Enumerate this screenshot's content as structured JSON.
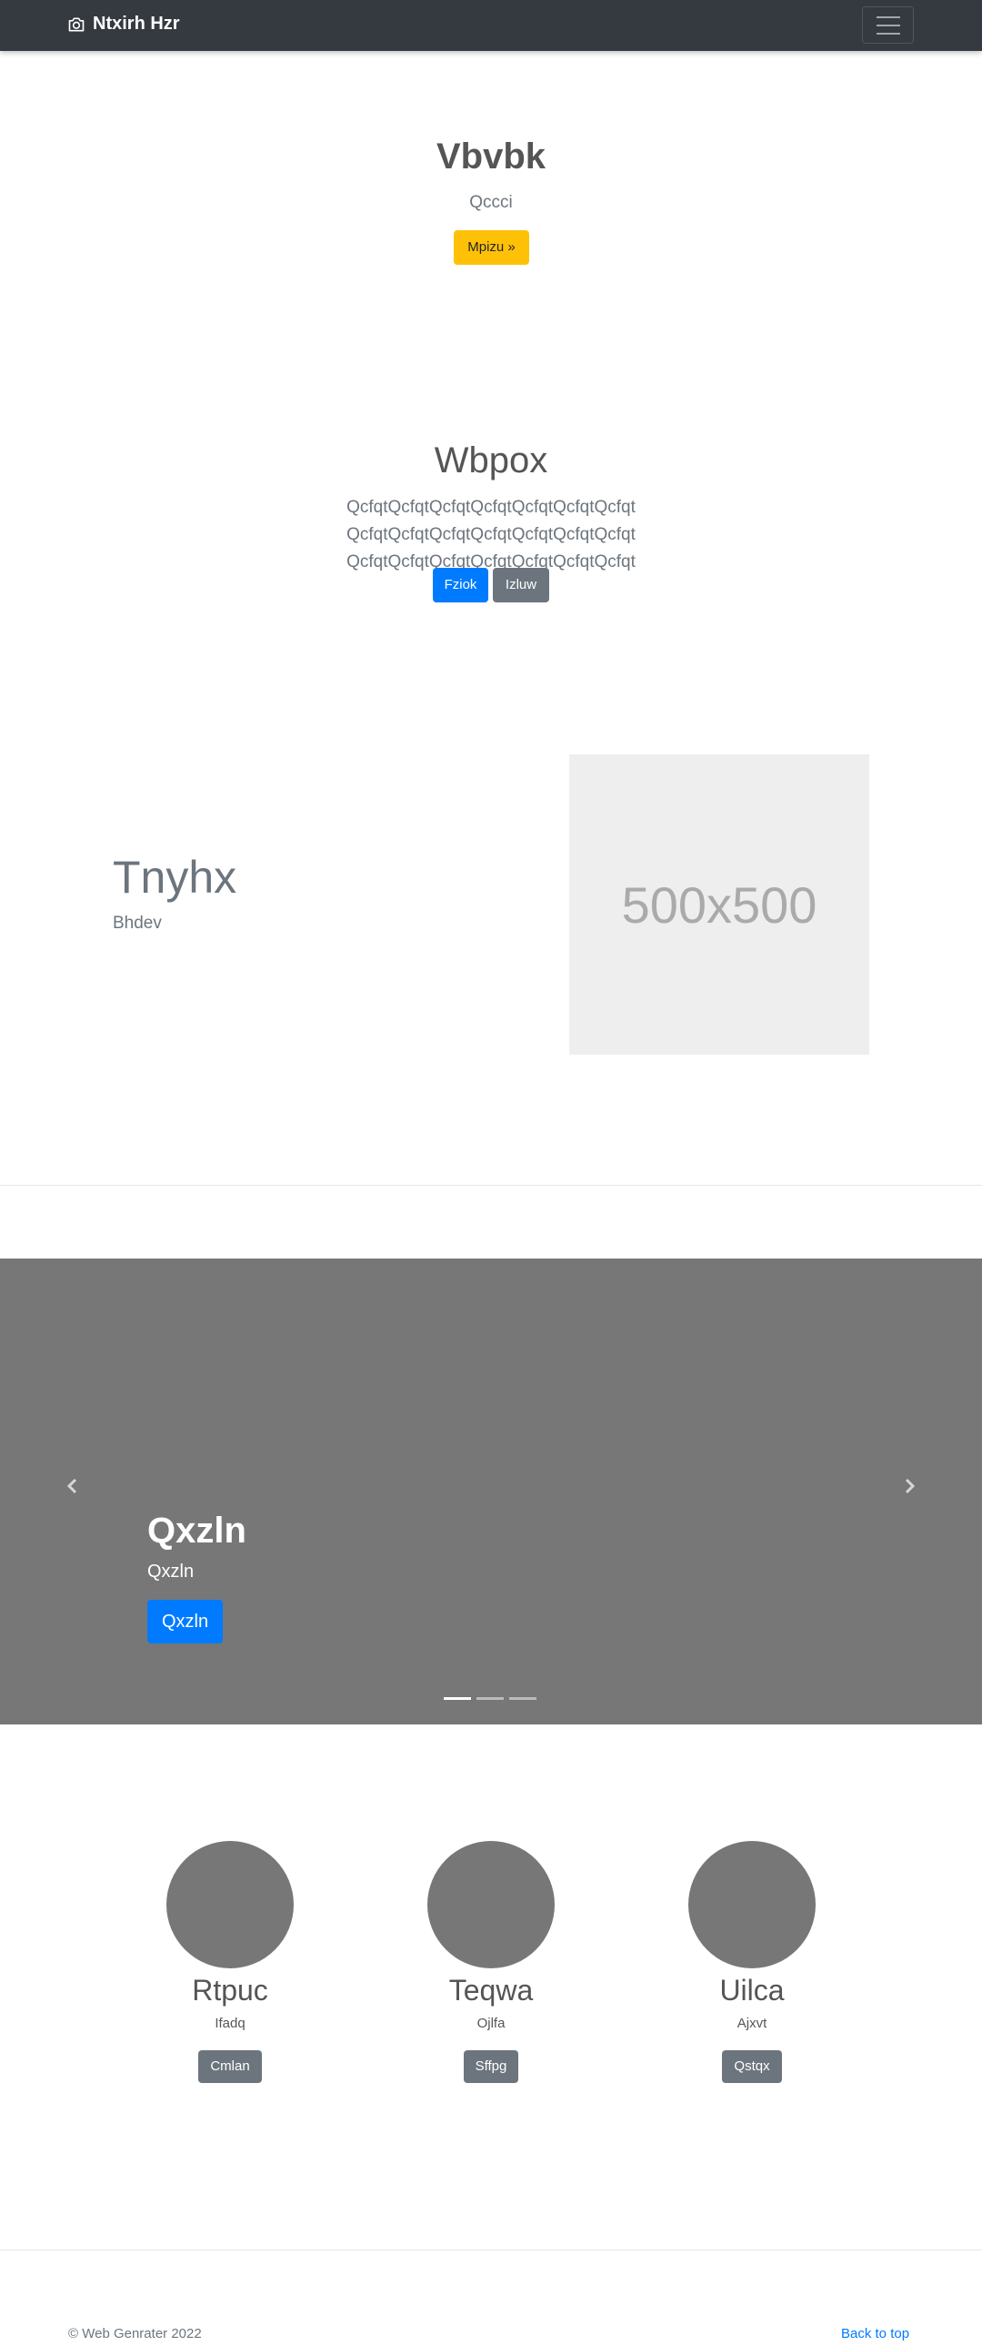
{
  "navbar": {
    "brand": "Ntxirh Hzr",
    "brand_icon": "camera-icon",
    "toggler_icon": "hamburger-menu-icon"
  },
  "hero1": {
    "title": "Vbvbk",
    "subtitle": "Qccci",
    "button_label": "Mpizu »"
  },
  "hero2": {
    "title": "Wbpox",
    "text": "QcfqtQcfqtQcfqtQcfqtQcfqtQcfqtQcfqt QcfqtQcfqtQcfqtQcfqtQcfqtQcfqtQcfqt QcfqtQcfqtQcfqtQcfqtQcfqtQcfqtQcfqt",
    "primary_label": "Fziok",
    "secondary_label": "Izluw"
  },
  "feature": {
    "title": "Tnyhx",
    "subtitle": "Bhdev",
    "image_placeholder": "500x500"
  },
  "carousel": {
    "title": "Qxzln",
    "subtitle": "Qxzln",
    "button_label": "Qxzln",
    "prev_icon": "chevron-left-icon",
    "next_icon": "chevron-right-icon",
    "slides": 3,
    "active_slide": 1
  },
  "team": [
    {
      "name": "Rtpuc",
      "role": "Ifadq",
      "button": "Cmlan"
    },
    {
      "name": "Teqwa",
      "role": "Ojlfa",
      "button": "Sffpg"
    },
    {
      "name": "Uilca",
      "role": "Ajxvt",
      "button": "Qstqx"
    }
  ],
  "footer": {
    "copyright": "© Web Genrater 2022",
    "back_to_top": "Back to top"
  },
  "colors": {
    "navbar_bg": "#343a40",
    "primary": "#007bff",
    "warning": "#ffc107",
    "secondary": "#6c757d",
    "carousel_bg": "#777777"
  }
}
